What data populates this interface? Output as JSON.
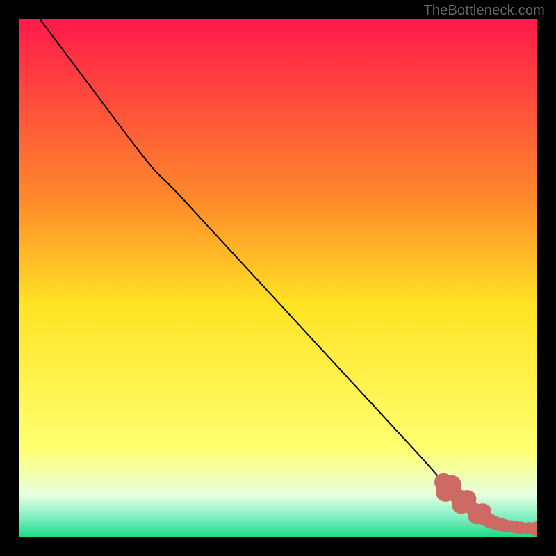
{
  "watermark": "TheBottleneck.com",
  "colors": {
    "gradient_top": "#ff1a4a",
    "gradient_upper_mid": "#ff9a2a",
    "gradient_mid": "#ffe324",
    "gradient_lower_mid": "#ffff70",
    "gradient_lower": "#e6ffcc",
    "gradient_bottom": "#1fdc82",
    "curve": "#000000",
    "marker": "#cc6a63",
    "frame": "#000000"
  },
  "chart_data": {
    "type": "line",
    "title": "",
    "xlabel": "",
    "ylabel": "",
    "xlim": [
      0,
      100
    ],
    "ylim": [
      0,
      100
    ],
    "grid": false,
    "legend": false,
    "background_gradient": {
      "direction": "vertical",
      "stops": [
        {
          "pos": 0.0,
          "color": "#ff1a4a"
        },
        {
          "pos": 0.35,
          "color": "#ff8a2a"
        },
        {
          "pos": 0.55,
          "color": "#ffe324"
        },
        {
          "pos": 0.83,
          "color": "#ffff70"
        },
        {
          "pos": 0.92,
          "color": "#e6ffe0"
        },
        {
          "pos": 0.965,
          "color": "#7aeec0"
        },
        {
          "pos": 1.0,
          "color": "#1fdc82"
        }
      ]
    },
    "series": [
      {
        "name": "curve",
        "x": [
          4,
          10,
          16,
          22,
          26,
          30,
          36,
          42,
          48,
          54,
          60,
          66,
          72,
          78,
          82,
          85,
          88,
          90,
          92,
          94,
          96,
          98,
          100
        ],
        "y": [
          100,
          92,
          84,
          76,
          71,
          67,
          60.5,
          54,
          47.5,
          41,
          34.5,
          28,
          21.5,
          15,
          10.5,
          7.5,
          5,
          3.5,
          2.6,
          2.1,
          1.8,
          1.6,
          1.5
        ]
      }
    ],
    "markers": {
      "name": "data-points",
      "x": [
        82,
        83.5,
        85,
        86.5,
        88,
        89,
        90,
        91,
        92,
        93,
        94,
        95,
        96,
        97,
        98.5,
        100
      ],
      "y": [
        10.5,
        9,
        7.5,
        6.3,
        5,
        4.2,
        3.5,
        3.0,
        2.6,
        2.35,
        2.1,
        1.95,
        1.8,
        1.7,
        1.6,
        1.5
      ],
      "r": [
        3.2,
        3.2,
        3.0,
        3.0,
        2.8,
        2.8,
        2.6,
        2.6,
        2.4,
        2.4,
        2.2,
        2.2,
        2.2,
        2.2,
        2.2,
        2.6
      ]
    },
    "marker_patches": [
      {
        "cx": 83.0,
        "cy": 9.3,
        "rx": 2.8,
        "ry": 2.2,
        "rot": -48
      },
      {
        "cx": 86.0,
        "cy": 6.7,
        "rx": 2.6,
        "ry": 2.0,
        "rot": -42
      },
      {
        "cx": 89.0,
        "cy": 4.4,
        "rx": 2.4,
        "ry": 1.8,
        "rot": -35
      }
    ]
  }
}
